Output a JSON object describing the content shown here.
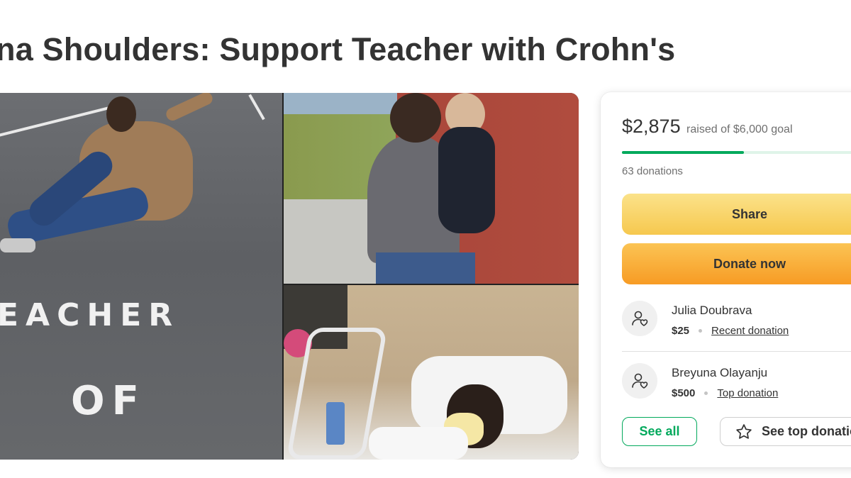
{
  "campaign": {
    "title": "na Shoulders: Support Teacher with Crohn's"
  },
  "collage": {
    "photo1": {
      "painted_text_line1": "EACHER",
      "painted_text_line2": "OF"
    }
  },
  "donation_card": {
    "raised": "$2,875",
    "goal_text": "raised of $6,000 goal",
    "progress_fraction": 0.479,
    "donation_count": "63 donations",
    "share_label": "Share",
    "donate_label": "Donate now",
    "donors": [
      {
        "name": "Julia Doubrava",
        "amount": "$25",
        "label": "Recent donation"
      },
      {
        "name": "Breyuna Olayanju",
        "amount": "$500",
        "label": "Top donation"
      }
    ],
    "see_all_label": "See all",
    "see_top_label": "See top donations",
    "colors": {
      "accent_green": "#02a95c",
      "share_yellow": "#f6c84e",
      "donate_orange": "#f79b24"
    },
    "icons": {
      "donor_avatar": "user-heart-icon",
      "see_top": "star-icon"
    }
  }
}
